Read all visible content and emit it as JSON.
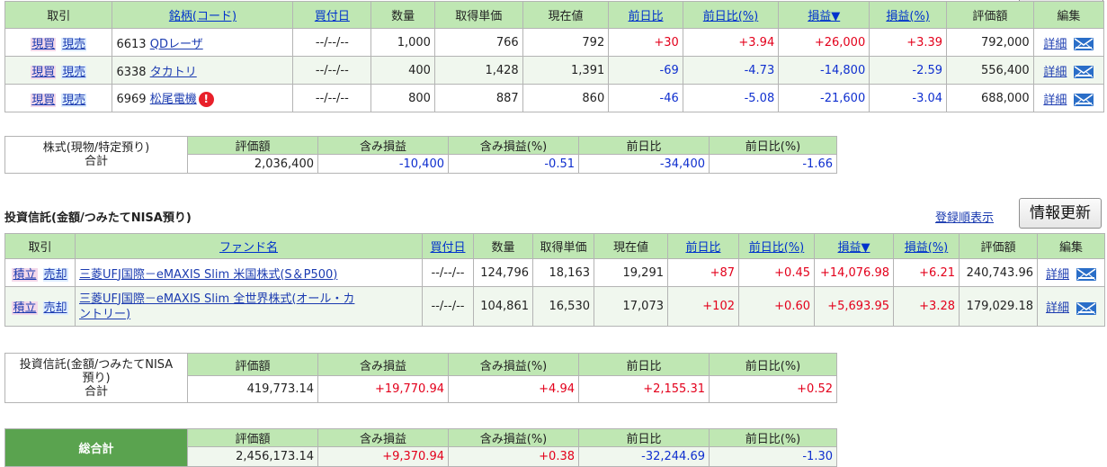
{
  "stock_table": {
    "headers": {
      "trade": "取引",
      "brand": "銘柄(コード)",
      "buy_date": "買付日",
      "qty": "数量",
      "cost": "取得単価",
      "price": "現在値",
      "chg": "前日比",
      "chg_pct": "前日比(%)",
      "pl": "損益▼",
      "pl_pct": "損益(%)",
      "value": "評価額",
      "edit": "編集"
    },
    "rows": [
      {
        "buy": "現買",
        "sell": "現売",
        "code": "6613",
        "name": "QDレーザ",
        "warn": "",
        "date": "--/--/--",
        "qty": "1,000",
        "cost": "766",
        "price": "792",
        "chg": "+30",
        "chg_pct": "+3.94",
        "pl": "+26,000",
        "pl_pct": "+3.39",
        "value": "792,000",
        "detail": "詳細"
      },
      {
        "buy": "現買",
        "sell": "現売",
        "code": "6338",
        "name": "タカトリ",
        "warn": "",
        "date": "--/--/--",
        "qty": "400",
        "cost": "1,428",
        "price": "1,391",
        "chg": "-69",
        "chg_pct": "-4.73",
        "pl": "-14,800",
        "pl_pct": "-2.59",
        "value": "556,400",
        "detail": "詳細"
      },
      {
        "buy": "現買",
        "sell": "現売",
        "code": "6969",
        "name": "松尾電機",
        "warn": "!",
        "date": "--/--/--",
        "qty": "800",
        "cost": "887",
        "price": "860",
        "chg": "-46",
        "chg_pct": "-5.08",
        "pl": "-21,600",
        "pl_pct": "-3.04",
        "value": "688,000",
        "detail": "詳細"
      }
    ]
  },
  "stock_summary": {
    "label_line1": "株式(現物/特定預り)",
    "label_line2": "合計",
    "headers": [
      "評価額",
      "含み損益",
      "含み損益(%)",
      "前日比",
      "前日比(%)"
    ],
    "values": [
      "2,036,400",
      "-10,400",
      "-0.51",
      "-34,400",
      "-1.66"
    ]
  },
  "fund_section": {
    "title": "投資信託(金額/つみたてNISA預り)",
    "registration_link": "登録順表示",
    "refresh_button": "情報更新"
  },
  "fund_table": {
    "headers": {
      "trade": "取引",
      "fund": "ファンド名",
      "buy_date": "買付日",
      "qty": "数量",
      "cost": "取得単価",
      "price": "現在値",
      "chg": "前日比",
      "chg_pct": "前日比(%)",
      "pl": "損益▼",
      "pl_pct": "損益(%)",
      "value": "評価額",
      "edit": "編集"
    },
    "rows": [
      {
        "buy": "積立",
        "sell": "売却",
        "name_line1": "三菱UFJ国際－eMAXIS Slim 米国株式(S＆P500)",
        "name_line2": "",
        "date": "--/--/--",
        "qty": "124,796",
        "cost": "18,163",
        "price": "19,291",
        "chg": "+87",
        "chg_pct": "+0.45",
        "pl": "+14,076.98",
        "pl_pct": "+6.21",
        "value": "240,743.96",
        "detail": "詳細"
      },
      {
        "buy": "積立",
        "sell": "売却",
        "name_line1": "三菱UFJ国際－eMAXIS Slim 全世界株式(オール・カ",
        "name_line2": "ントリー)",
        "date": "--/--/--",
        "qty": "104,861",
        "cost": "16,530",
        "price": "17,073",
        "chg": "+102",
        "chg_pct": "+0.60",
        "pl": "+5,693.95",
        "pl_pct": "+3.28",
        "value": "179,029.18",
        "detail": "詳細"
      }
    ]
  },
  "fund_summary": {
    "label_line1": "投資信託(金額/つみたてNISA",
    "label_line2": "預り)",
    "label_line3": "合計",
    "headers": [
      "評価額",
      "含み損益",
      "含み損益(%)",
      "前日比",
      "前日比(%)"
    ],
    "values": [
      "419,773.14",
      "+19,770.94",
      "+4.94",
      "+2,155.31",
      "+0.52"
    ]
  },
  "grand_total": {
    "label": "総合計",
    "headers": [
      "評価額",
      "含み損益",
      "含み損益(%)",
      "前日比",
      "前日比(%)"
    ],
    "values": [
      "2,456,173.14",
      "+9,370.94",
      "+0.38",
      "-32,244.69",
      "-1.30"
    ]
  },
  "colors": {
    "header_green": "#bfe7b3",
    "total_green": "#5aa34f",
    "positive": "#e3001b",
    "negative": "#0f2fcf",
    "link": "#1b3bb0"
  }
}
